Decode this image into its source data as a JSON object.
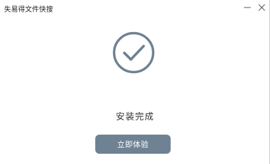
{
  "window": {
    "title": "失易得文件快搜"
  },
  "status": {
    "text": "安装完成",
    "icon": "check-circle-icon"
  },
  "actions": {
    "experience_label": "立即体验"
  },
  "colors": {
    "accent": "#6f8294",
    "icon": "#6e8193",
    "text": "#333333"
  }
}
